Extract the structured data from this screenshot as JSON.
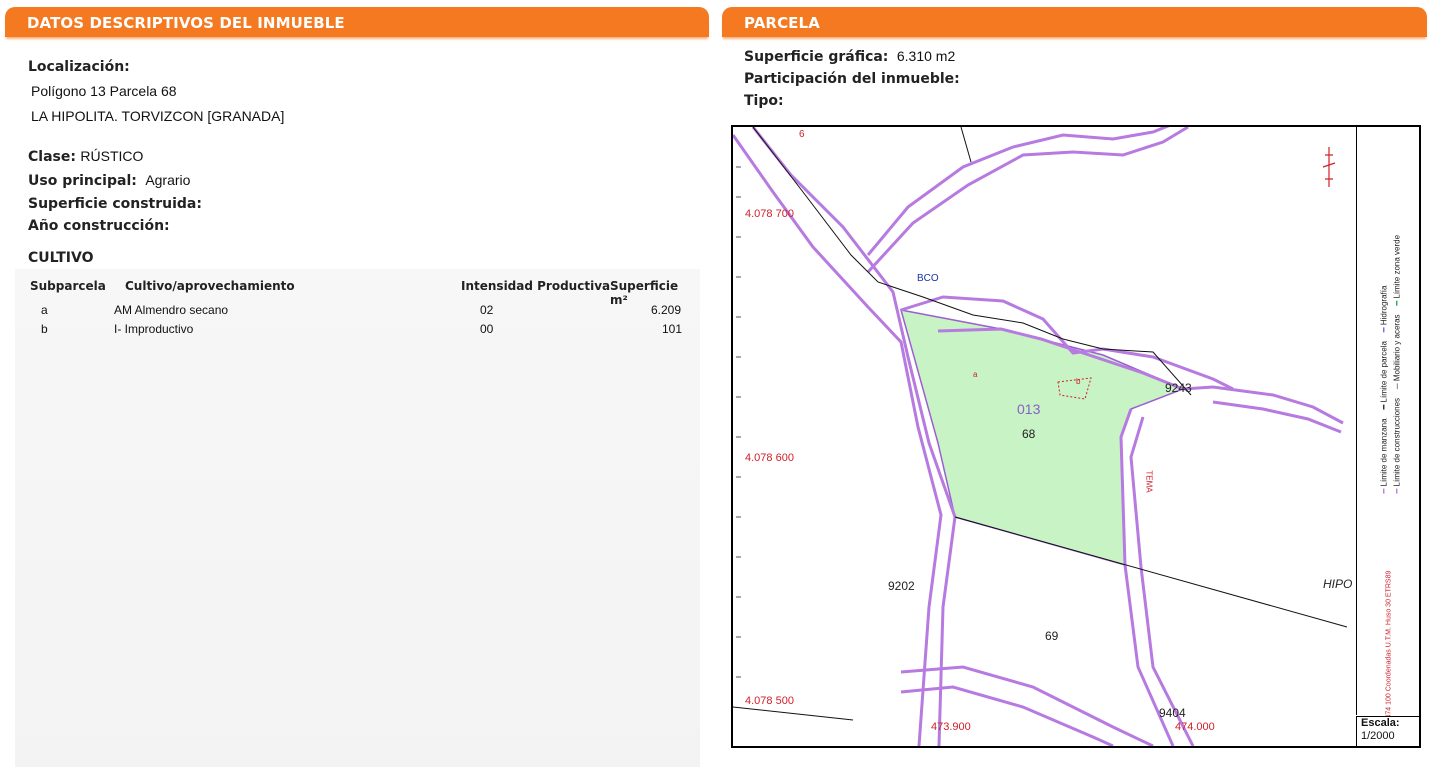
{
  "left_panel": {
    "title": "DATOS DESCRIPTIVOS DEL INMUEBLE",
    "localizacion_label": "Localización:",
    "localizacion_line1": "Polígono 13 Parcela 68",
    "localizacion_line2": "LA HIPOLITA. TORVIZCON [GRANADA]",
    "clase_label": "Clase:",
    "clase_value": "RÚSTICO",
    "uso_label": "Uso principal:",
    "uso_value": "Agrario",
    "superficie_label": "Superficie construida:",
    "anio_label": "Año construcción:",
    "cultivo_title": "CULTIVO",
    "cultivo_headers": [
      "Subparcela",
      "Cultivo/aprovechamiento",
      "Intensidad Productiva",
      "Superficie m²"
    ],
    "cultivo_rows": [
      [
        "a",
        "AM Almendro secano",
        "02",
        "6.209"
      ],
      [
        "b",
        "I- Improductivo",
        "00",
        "101"
      ]
    ]
  },
  "right_panel": {
    "title": "PARCELA",
    "superficie_label": "Superficie gráfica:",
    "superficie_value": "6.310 m2",
    "participacion_label": "Participación del inmueble:",
    "tipo_label": "Tipo:"
  },
  "map": {
    "y_coords": [
      "4.078 700",
      "4.078 600",
      "4.078 500"
    ],
    "x_coords": [
      "473.900",
      "474.000"
    ],
    "labels": {
      "bco": "BCO",
      "poligono": "013",
      "parcela": "68",
      "sub_a": "a",
      "sub_b": "b",
      "p9243": "9243",
      "p9202": "9202",
      "p69": "69",
      "p9404": "9404",
      "hipo": "HIPO",
      "top_num": "6",
      "tema": "TEMA"
    },
    "legend": {
      "limite_manzana": "Límite de manzana",
      "limite_parcela": "Límite de parcela",
      "hidrografia": "Hidrografía",
      "limite_construcciones": "Límite de construcciones",
      "mobiliario": "Mobiliario y aceras",
      "zona_verde": "Límite zona verde",
      "coordenadas": "474 100 Coordenadas U.T.M. Huso 30 ETRS89"
    },
    "scale_label": "Escala:",
    "scale_value": "1/2000",
    "colors": {
      "parcel_fill": "#c8f3c4",
      "boundary": "#b77ae0",
      "coord_red": "#d0202a",
      "accent_orange": "#f47920"
    }
  }
}
